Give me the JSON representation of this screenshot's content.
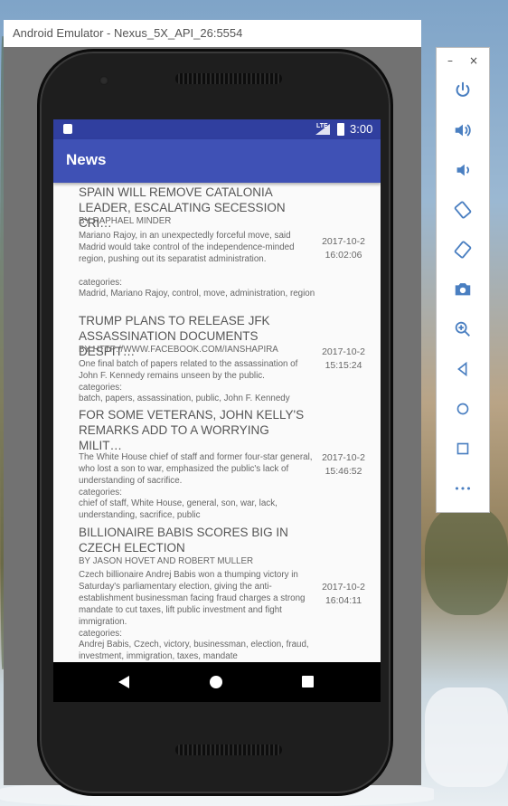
{
  "window": {
    "title": "Android Emulator - Nexus_5X_API_26:5554"
  },
  "status_bar": {
    "network": "LTE",
    "time": "3:00"
  },
  "app_bar": {
    "title": "News"
  },
  "news": [
    {
      "title": "SPAIN WILL REMOVE CATALONIA LEADER, ESCALATING SECESSION CRI…",
      "author": "BY RAPHAEL MINDER",
      "description": "Mariano Rajoy, in an unexpectedly forceful move, said Madrid would take control of the independence-minded region, pushing out its separatist administration.",
      "categories_label": "categories:",
      "categories": "Madrid, Mariano Rajoy, control, move, administration, region",
      "date": "2017-10-2",
      "time": "16:02:06"
    },
    {
      "title": "TRUMP PLANS TO RELEASE JFK ASSASSINATION DOCUMENTS DESPIT…",
      "author": "BY HTTP://WWW.FACEBOOK.COM/IANSHAPIRA",
      "description": "One final batch of papers related to the assassination of John F. Kennedy remains unseen by the public.",
      "categories_label": "categories:",
      "categories": "batch, papers, assassination, public, John F. Kennedy",
      "date": "2017-10-2",
      "time": "15:15:24"
    },
    {
      "title": "FOR SOME VETERANS, JOHN KELLY'S REMARKS ADD TO A WORRYING MILIT…",
      "author": "",
      "description": "The White House chief of staff and former four-star general, who lost a son to war, emphasized the public's lack of understanding of sacrifice.",
      "categories_label": "categories:",
      "categories": "chief of staff, White House, general, son, war, lack, understanding, sacrifice, public",
      "date": "2017-10-2",
      "time": "15:46:52"
    },
    {
      "title": "BILLIONAIRE BABIS SCORES BIG IN CZECH ELECTION",
      "author": "BY JASON HOVET AND ROBERT MULLER",
      "description": "Czech billionaire Andrej Babis won a thumping victory in Saturday's parliamentary election, giving the anti-establishment businessman facing fraud charges a strong mandate to cut taxes, lift public investment and fight immigration.",
      "categories_label": "categories:",
      "categories": "Andrej Babis, Czech, victory, businessman, election, fraud, investment, immigration, taxes, mandate",
      "date": "2017-10-2",
      "time": "16:04:11"
    }
  ],
  "emulator_panel": {
    "minimize": "–",
    "close": "×",
    "more": "•••"
  }
}
